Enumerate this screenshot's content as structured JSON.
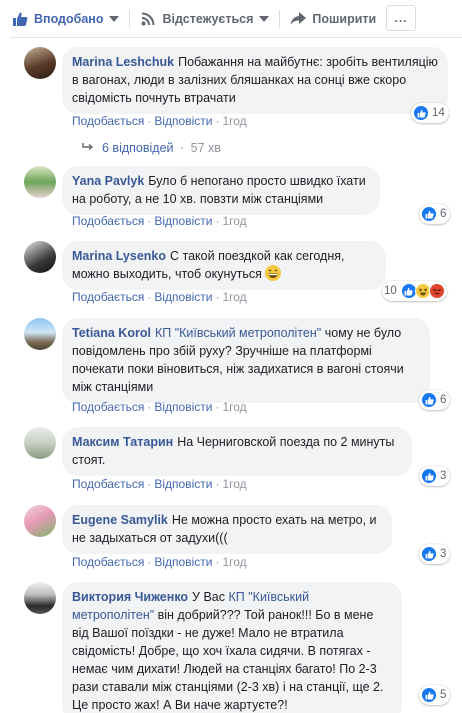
{
  "action_bar": {
    "like_label": "Вподобано",
    "follow_label": "Відстежується",
    "share_label": "Поширити",
    "more_label": "..."
  },
  "comments": [
    {
      "author": "Marina Leshchuk",
      "text": "Побажання на майбутнє: зробіть вентиляцію в вагонах, люди в залізних бляшанках на сонці вже скоро свідомість почнуть втрачати",
      "like": "Подобається",
      "reply": "Відповісти",
      "time": "1год",
      "reactions_count": "14",
      "replies_label": "6 відповідей",
      "replies_time": "57 хв"
    },
    {
      "author": "Yana Pavlyk",
      "text": "Було б непогано просто швидко їхати на роботу, а не 10 хв. повзти між станціями",
      "like": "Подобається",
      "reply": "Відповісти",
      "time": "1год",
      "reactions_count": "6"
    },
    {
      "author": "Marina Lysenko",
      "text": "С такой поездкой как сегодня, можно выходить, чтоб окунуться",
      "like": "Подобається",
      "reply": "Відповісти",
      "time": "1год",
      "reactions_count": "10"
    },
    {
      "author": "Tetiana Korol",
      "tag": "КП \"Київський метрополітен\"",
      "text": "чому не було повідомлень про збій руху? Зручніше на платформі почекати поки віновиться, ніж задихатися в вагоні стоячи між станціями",
      "like": "Подобається",
      "reply": "Відповісти",
      "time": "1год",
      "reactions_count": "6"
    },
    {
      "author": "Максим Татарин",
      "text": "На Черниговской поезда по 2 минуты стоят.",
      "like": "Подобається",
      "reply": "Відповісти",
      "time": "1год",
      "reactions_count": "3"
    },
    {
      "author": "Eugene Samylik",
      "text": "Не можна просто ехать на метро, и не задыхаться от задухи(((",
      "like": "Подобається",
      "reply": "Відповісти",
      "time": "1год",
      "reactions_count": "3"
    },
    {
      "author": "Виктория Чиженко",
      "prefix": "У Вас",
      "tag": "КП \"Київський метрополітен\"",
      "text": "він добрий??? Той ранок!!! Бо в мене від Вашої поїздки - не дуже! Мало не втратила свідомість! Добре, що хоч їхала сидячи. В потягах - немає чим дихати! Людей на станціях багато! По 2-3 рази ставали між станціями (2-3 хв) і на станції, ще 2. Це просто жах! А Ви наче жартуєте?!",
      "reactions_count": "5"
    }
  ],
  "colors": {
    "link_blue": "#385898",
    "meta_grey": "#90949c",
    "bubble_bg": "#f2f3f5",
    "like_blue": "#1877f2"
  }
}
